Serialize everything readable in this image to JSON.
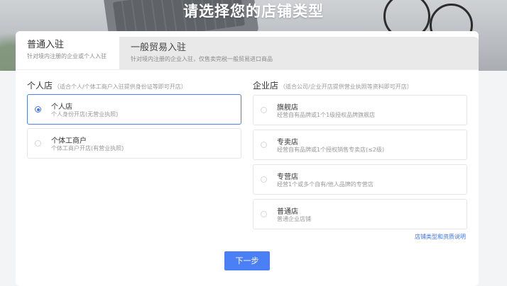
{
  "page": {
    "title": "请选择您的店铺类型"
  },
  "tabs": [
    {
      "label": "普通入驻",
      "sub": "针对境内注册的企业或个人入驻"
    },
    {
      "label": "一般贸易入驻",
      "sub": "针对境内注册的企业入驻，仅售卖完税一般贸易进口商品"
    }
  ],
  "personal": {
    "heading": "个人店",
    "hint": "（适合个人/个体工商户入驻提供身份证等即可开店）",
    "options": [
      {
        "title": "个人店",
        "desc": "个人身份开店(无营业执照)",
        "selected": true
      },
      {
        "title": "个体工商户",
        "desc": "个体工商户开店(有营业执照)",
        "selected": false
      }
    ]
  },
  "enterprise": {
    "heading": "企业店",
    "hint": "（适合公司/企业开店提供营业执照等资料即可开店）",
    "options": [
      {
        "title": "旗舰店",
        "desc": "经营自有品牌或1个1级授权品牌旗舰店"
      },
      {
        "title": "专卖店",
        "desc": "经营自有品牌或1个授权销售专卖店(≤2级)"
      },
      {
        "title": "专营店",
        "desc": "经营1个或多个自有/他人品牌的专营店"
      },
      {
        "title": "普通店",
        "desc": "普通企业店铺"
      }
    ],
    "link": "店铺类型和资质说明"
  },
  "actions": {
    "next": "下一步"
  },
  "colors": {
    "accent": "#4a7ff5",
    "selected_border": "#4d7df1",
    "tab_inactive_bg": "#e9e9ea"
  }
}
